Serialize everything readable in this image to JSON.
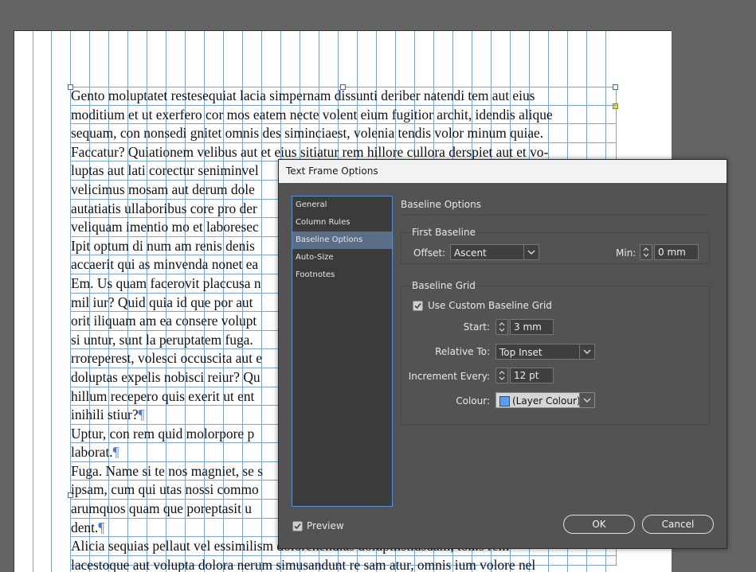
{
  "document": {
    "lines": [
      "Gento moluptatet restesequiat lacia simpernam dissunti deriber natendi tem aut eius",
      "moditium et ut exerfero cor mos eatem necte volent eium fugitior archit, idendis alique",
      "sequam, con nonsedi gnitet omnis des siminciaest, volenia tendis volor minum quiae.",
      "Faccatur? Quiationem velibus aut et eius sitiatur rem hillore cullora derspiet aut et vo-",
      "luptas aut lati corectur seniminvel",
      "velicimus mosam aut derum dole",
      "autatiatis ullaboribus core pro der",
      "veliquam imentio mo et laboresec",
      "Ipit optum di num am renis denis",
      "accaerit qui as minvenda nonet ea",
      "Em. Us quam facerovit placcusa n",
      "mil iur? Quid quia id que por aut",
      "orit iliquam am ea consere volupt",
      "si untur, sunt la peruptatem fuga.",
      "rroreperest, volesci occuscita aut e",
      "doluptas expelis nobisci reiur? Qu",
      "hillum recepero quis exerit ut ent",
      "inihili stiur?",
      "Uptur, con rem quid molorpore p",
      "laborat.",
      "Fuga. Name si te nos magniet, se s",
      "ipsam, cum qui utas nossi commo",
      "arumquos quam que poreptasit u",
      "dent.",
      "Alicia sequias pellaut vel essimilism dolorenendias doluptiistiusdam, tonis rem",
      "lacestoque aut volupta dolora nerum simusandunt re sam atur, omnis ium volore nel"
    ],
    "pilcrow": "¶"
  },
  "dialog": {
    "title": "Text Frame Options",
    "nav": [
      "General",
      "Column Rules",
      "Baseline Options",
      "Auto-Size",
      "Footnotes"
    ],
    "selected_nav": "Baseline Options",
    "section_title": "Baseline Options",
    "first_baseline": {
      "legend": "First Baseline",
      "offset_label": "Offset:",
      "offset_value": "Ascent",
      "min_label": "Min:",
      "min_value": "0 mm"
    },
    "baseline_grid": {
      "legend": "Baseline Grid",
      "use_custom_label": "Use Custom Baseline Grid",
      "use_custom_checked": true,
      "start_label": "Start:",
      "start_value": "3 mm",
      "relative_label": "Relative To:",
      "relative_value": "Top Inset",
      "increment_label": "Increment Every:",
      "increment_value": "12 pt",
      "colour_label": "Colour:",
      "colour_value": "(Layer Colour)",
      "colour_swatch": "#5b9cf0"
    },
    "preview_label": "Preview",
    "preview_checked": true,
    "ok_label": "OK",
    "cancel_label": "Cancel"
  },
  "colors": {
    "pasteboard": "#646464",
    "dialog_bg": "#535353",
    "guide": "#7ea2d6",
    "selection": "#5a6e88"
  }
}
